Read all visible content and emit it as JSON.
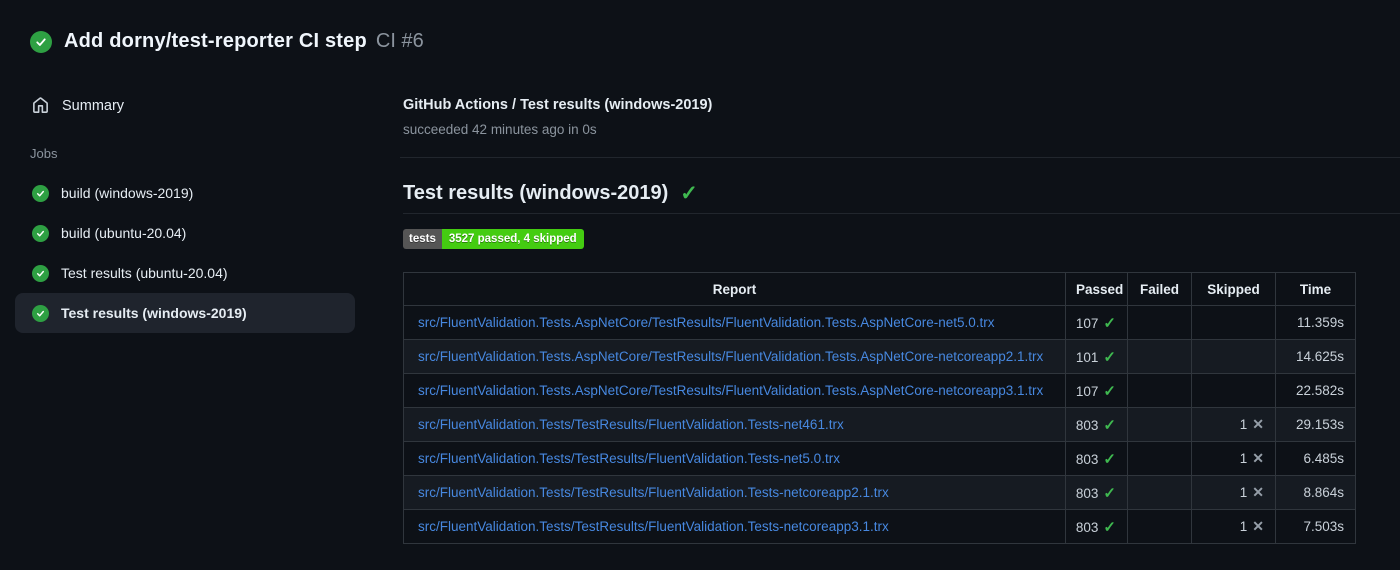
{
  "header": {
    "title": "Add dorny/test-reporter CI step",
    "run_label": "CI #6"
  },
  "sidebar": {
    "summary_label": "Summary",
    "jobs_label": "Jobs",
    "jobs": [
      {
        "label": "build (windows-2019)",
        "selected": false
      },
      {
        "label": "build (ubuntu-20.04)",
        "selected": false
      },
      {
        "label": "Test results (ubuntu-20.04)",
        "selected": false
      },
      {
        "label": "Test results (windows-2019)",
        "selected": true
      }
    ]
  },
  "main": {
    "check_title": "GitHub Actions / Test results (windows-2019)",
    "status_line": "succeeded 42 minutes ago in 0s",
    "section_title": "Test results (windows-2019)",
    "badge": {
      "label": "tests",
      "value": "3527 passed, 4 skipped",
      "label_bg": "#555555",
      "value_bg": "#44cc11"
    },
    "table": {
      "columns": [
        "Report",
        "Passed",
        "Failed",
        "Skipped",
        "Time"
      ],
      "rows": [
        {
          "report": "src/FluentValidation.Tests.AspNetCore/TestResults/FluentValidation.Tests.AspNetCore-net5.0.trx",
          "passed": "107",
          "failed": "",
          "skipped": "",
          "time": "11.359s"
        },
        {
          "report": "src/FluentValidation.Tests.AspNetCore/TestResults/FluentValidation.Tests.AspNetCore-netcoreapp2.1.trx",
          "passed": "101",
          "failed": "",
          "skipped": "",
          "time": "14.625s"
        },
        {
          "report": "src/FluentValidation.Tests.AspNetCore/TestResults/FluentValidation.Tests.AspNetCore-netcoreapp3.1.trx",
          "passed": "107",
          "failed": "",
          "skipped": "",
          "time": "22.582s"
        },
        {
          "report": "src/FluentValidation.Tests/TestResults/FluentValidation.Tests-net461.trx",
          "passed": "803",
          "failed": "",
          "skipped": "1",
          "time": "29.153s"
        },
        {
          "report": "src/FluentValidation.Tests/TestResults/FluentValidation.Tests-net5.0.trx",
          "passed": "803",
          "failed": "",
          "skipped": "1",
          "time": "6.485s"
        },
        {
          "report": "src/FluentValidation.Tests/TestResults/FluentValidation.Tests-netcoreapp2.1.trx",
          "passed": "803",
          "failed": "",
          "skipped": "1",
          "time": "8.864s"
        },
        {
          "report": "src/FluentValidation.Tests/TestResults/FluentValidation.Tests-netcoreapp3.1.trx",
          "passed": "803",
          "failed": "",
          "skipped": "1",
          "time": "7.503s"
        }
      ]
    },
    "colors": {
      "passed_check": "#3fb950",
      "skipped_cross": "#959ea8",
      "link": "#4788e0",
      "status_green": "#2ea043"
    }
  }
}
